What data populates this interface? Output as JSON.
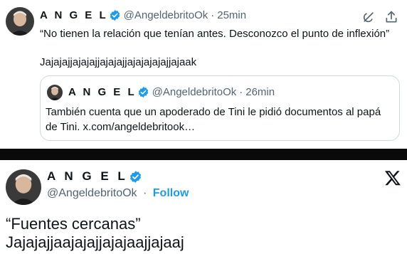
{
  "top_tweet": {
    "author_name": "A N G E L",
    "handle": "@AngeldebritoOk",
    "separator": "·",
    "time": "25min",
    "icons": [
      "grok-icon",
      "share-icon"
    ],
    "text_line_1": "“No tienen la relación que tenían antes. Desconozco el punto de inflexión”",
    "text_line_2": "Jajajajjajajajjajajajjajajajajajjajaak",
    "quoted": {
      "author_name": "A N G E L",
      "handle": "@AngeldebritoOk",
      "separator": "·",
      "time": "26min",
      "text": "También cuenta que un apoderado de Tini le pidió documentos al papá de Tini. x.com/angeldebritook…"
    }
  },
  "bottom_embed": {
    "author_name": "A N G E L",
    "handle": "@AngeldebritoOk",
    "separator": "·",
    "follow_label": "Follow",
    "logo": "x-logo-icon",
    "text_line_1": "“Fuentes cercanas”",
    "text_line_2": "Jajajajjaajajajjajajaajjajaaj"
  },
  "colors": {
    "verified": "#1d9bf0",
    "link": "#1d9bf0",
    "secondary_text": "#536471",
    "border": "#cfd9de",
    "separator_bar": "#0a0a0a"
  }
}
